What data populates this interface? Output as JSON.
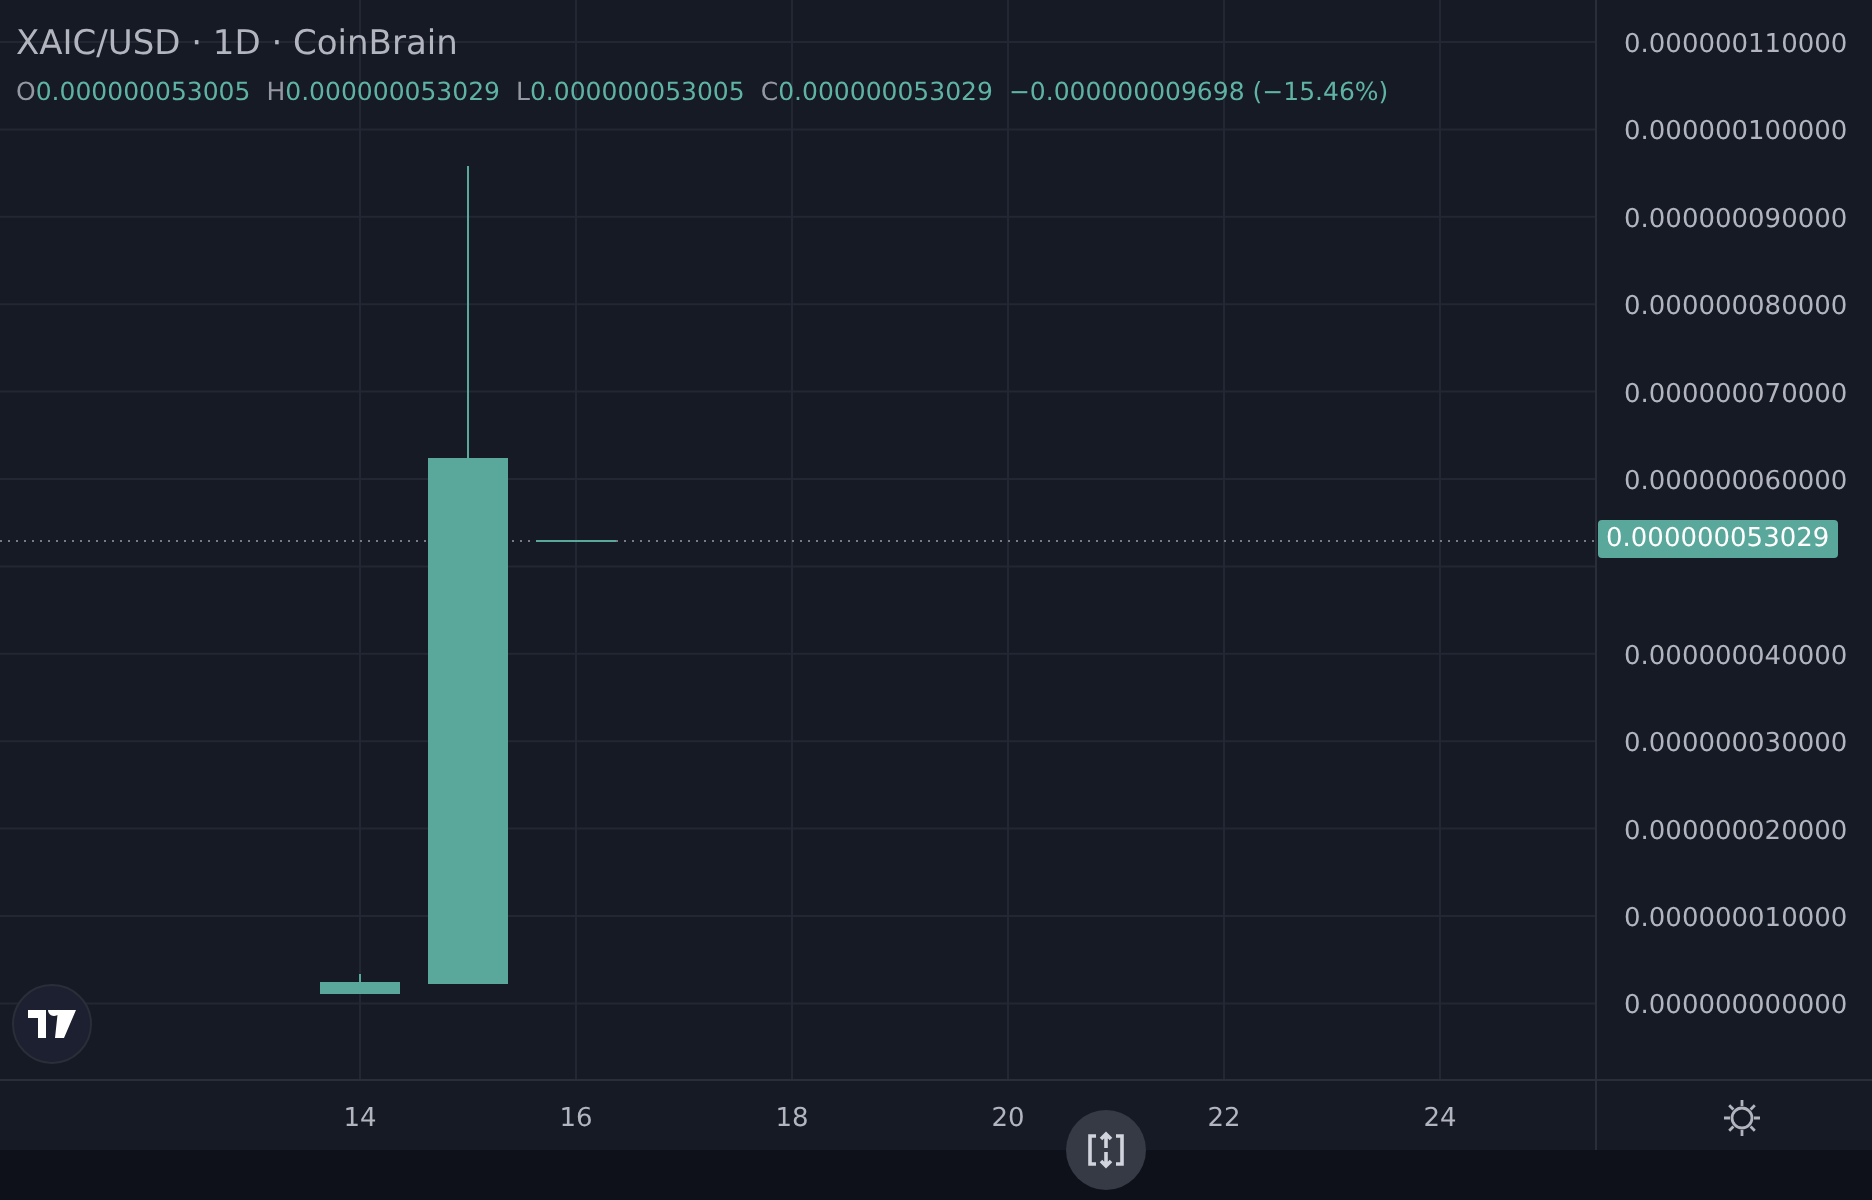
{
  "legend": {
    "title": "XAIC/USD · 1D · CoinBrain",
    "ohlc": [
      {
        "label": "O",
        "value": "0.000000053005"
      },
      {
        "label": "H",
        "value": "0.000000053029"
      },
      {
        "label": "L",
        "value": "0.000000053005"
      },
      {
        "label": "C",
        "value": "0.000000053029"
      }
    ],
    "change": "−0.000000009698 (−15.46%)"
  },
  "price_label": "0.000000053029",
  "price_axis": [
    "0.000000110000",
    "0.000000100000",
    "0.000000090000",
    "0.000000080000",
    "0.000000070000",
    "0.000000060000",
    "0.000000040000",
    "0.000000030000",
    "0.000000020000",
    "0.000000010000",
    "0.000000000000"
  ],
  "time_axis": [
    "14",
    "16",
    "18",
    "20",
    "22",
    "24"
  ]
}
